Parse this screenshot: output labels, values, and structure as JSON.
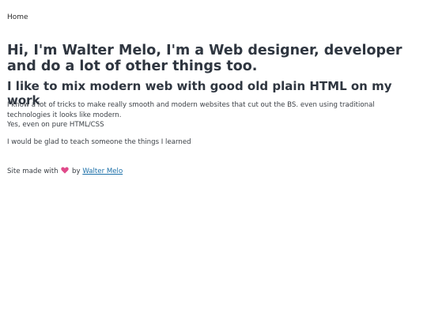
{
  "nav": {
    "home": "Home"
  },
  "hero": {
    "title": "Hi, I'm Walter Melo, I'm a Web designer, developer and do a lot of other things too.",
    "subtitle": "I like to mix modern web with good old plain HTML on my work"
  },
  "content": {
    "paragraph1_line1": "I know a lot of tricks to make really smooth and modern websites that cut out the BS. even using traditional technologies it looks like modern.",
    "paragraph1_line2": "Yes, even on pure HTML/CSS",
    "paragraph2": "I would be glad to teach someone the things I learned"
  },
  "footer": {
    "prefix": "Site made with",
    "heart_icon": "heart-icon",
    "by": "by",
    "author": "Walter Melo"
  },
  "colors": {
    "text": "#2f3640",
    "link": "#1b6fa8",
    "heart": "#e04a8a"
  }
}
